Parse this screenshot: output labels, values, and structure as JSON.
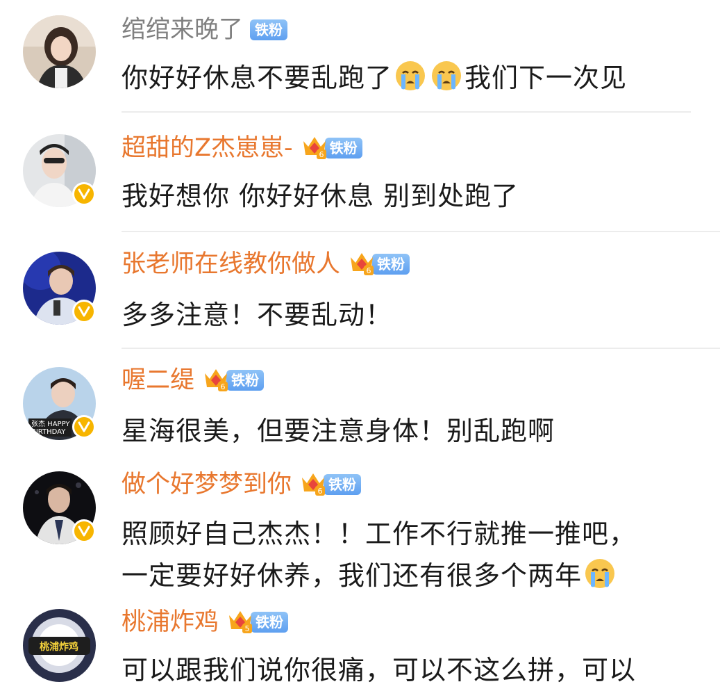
{
  "badge_label": "铁粉",
  "comments": [
    {
      "username": "绾绾来晚了",
      "text_a": "你好好休息不要乱跑了",
      "text_b": "我们下一次见"
    },
    {
      "username": "超甜的Z杰崽崽-",
      "text": "我好想你 你好好休息 别到处跑了"
    },
    {
      "username": "张老师在线教你做人",
      "text": "多多注意！不要乱动！"
    },
    {
      "username": "喔二缇",
      "text": "星海很美，但要注意身体！别乱跑啊"
    },
    {
      "username": "做个好梦梦到你",
      "line1": "照顾好自己杰杰！！工作不行就推一推吧，",
      "line2": "一定要好好休养，我们还有很多个两年"
    },
    {
      "username": "桃浦炸鸡",
      "text": "可以跟我们说你很痛，可以不这么拼，可以"
    }
  ],
  "avatar_texts": {
    "avatar_4_line1": "张杰 HAPPY",
    "avatar_4_line2": "BIRTHDAY",
    "avatar_6": "桃浦炸鸡"
  },
  "fan_levels": [
    "6",
    "6",
    "6",
    "6",
    "5"
  ],
  "colors": {
    "username_vip": "#e8772e",
    "username_plain": "#808080",
    "badge_blue": "#5e9ff0",
    "verified_gold": "#f7b500",
    "divider": "#ececec"
  },
  "icons": {
    "crying_emoji": "crying-emoji-icon",
    "crown_badge": "crown-icon",
    "verified": "verified-v-icon"
  }
}
